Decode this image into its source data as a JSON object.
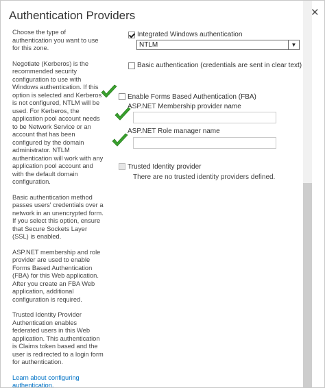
{
  "dialog": {
    "title": "Authentication Providers",
    "close_glyph": "✕"
  },
  "help": {
    "paragraphs": [
      "Choose the type of authentication you want to use for this zone.",
      "Negotiate (Kerberos) is the recommended security configuration to use with Windows authentication. If this option is selected and Kerberos is not configured, NTLM will be used. For Kerberos, the application pool account needs to be Network Service or an account that has been configured by the domain administrator. NTLM authentication will work with any application pool account and with the default domain configuration.",
      "Basic authentication method passes users' credentials over a network in an unencrypted form. If you select this option, ensure that Secure Sockets Layer (SSL) is enabled.",
      "ASP.NET membership and role provider are used to enable Forms Based Authentication (FBA) for this Web application. After you create an FBA Web application, additional configuration is required.",
      "Trusted Identity Provider Authentication enables federated users in this Web application. This authentication is Claims token based and the user is redirected to a login form for authentication."
    ],
    "link": "Learn about configuring authentication."
  },
  "options": {
    "windows_label": "Integrated Windows authentication",
    "windows_checked": true,
    "windows_mode_value": "NTLM",
    "basic_label": "Basic authentication (credentials are sent in clear text)",
    "basic_checked": false,
    "fba_label": "Enable Forms Based Authentication (FBA)",
    "fba_checked": false,
    "membership_label": "ASP.NET Membership provider name",
    "membership_value": "",
    "role_label": "ASP.NET Role manager name",
    "role_value": "",
    "trusted_label": "Trusted Identity provider",
    "trusted_note": "There are no trusted identity providers defined."
  },
  "colors": {
    "link": "#0072c6",
    "tick_green": "#3aa12f"
  },
  "icons": [
    "close-icon",
    "green-checkmark-icon",
    "dropdown-arrow-icon"
  ]
}
